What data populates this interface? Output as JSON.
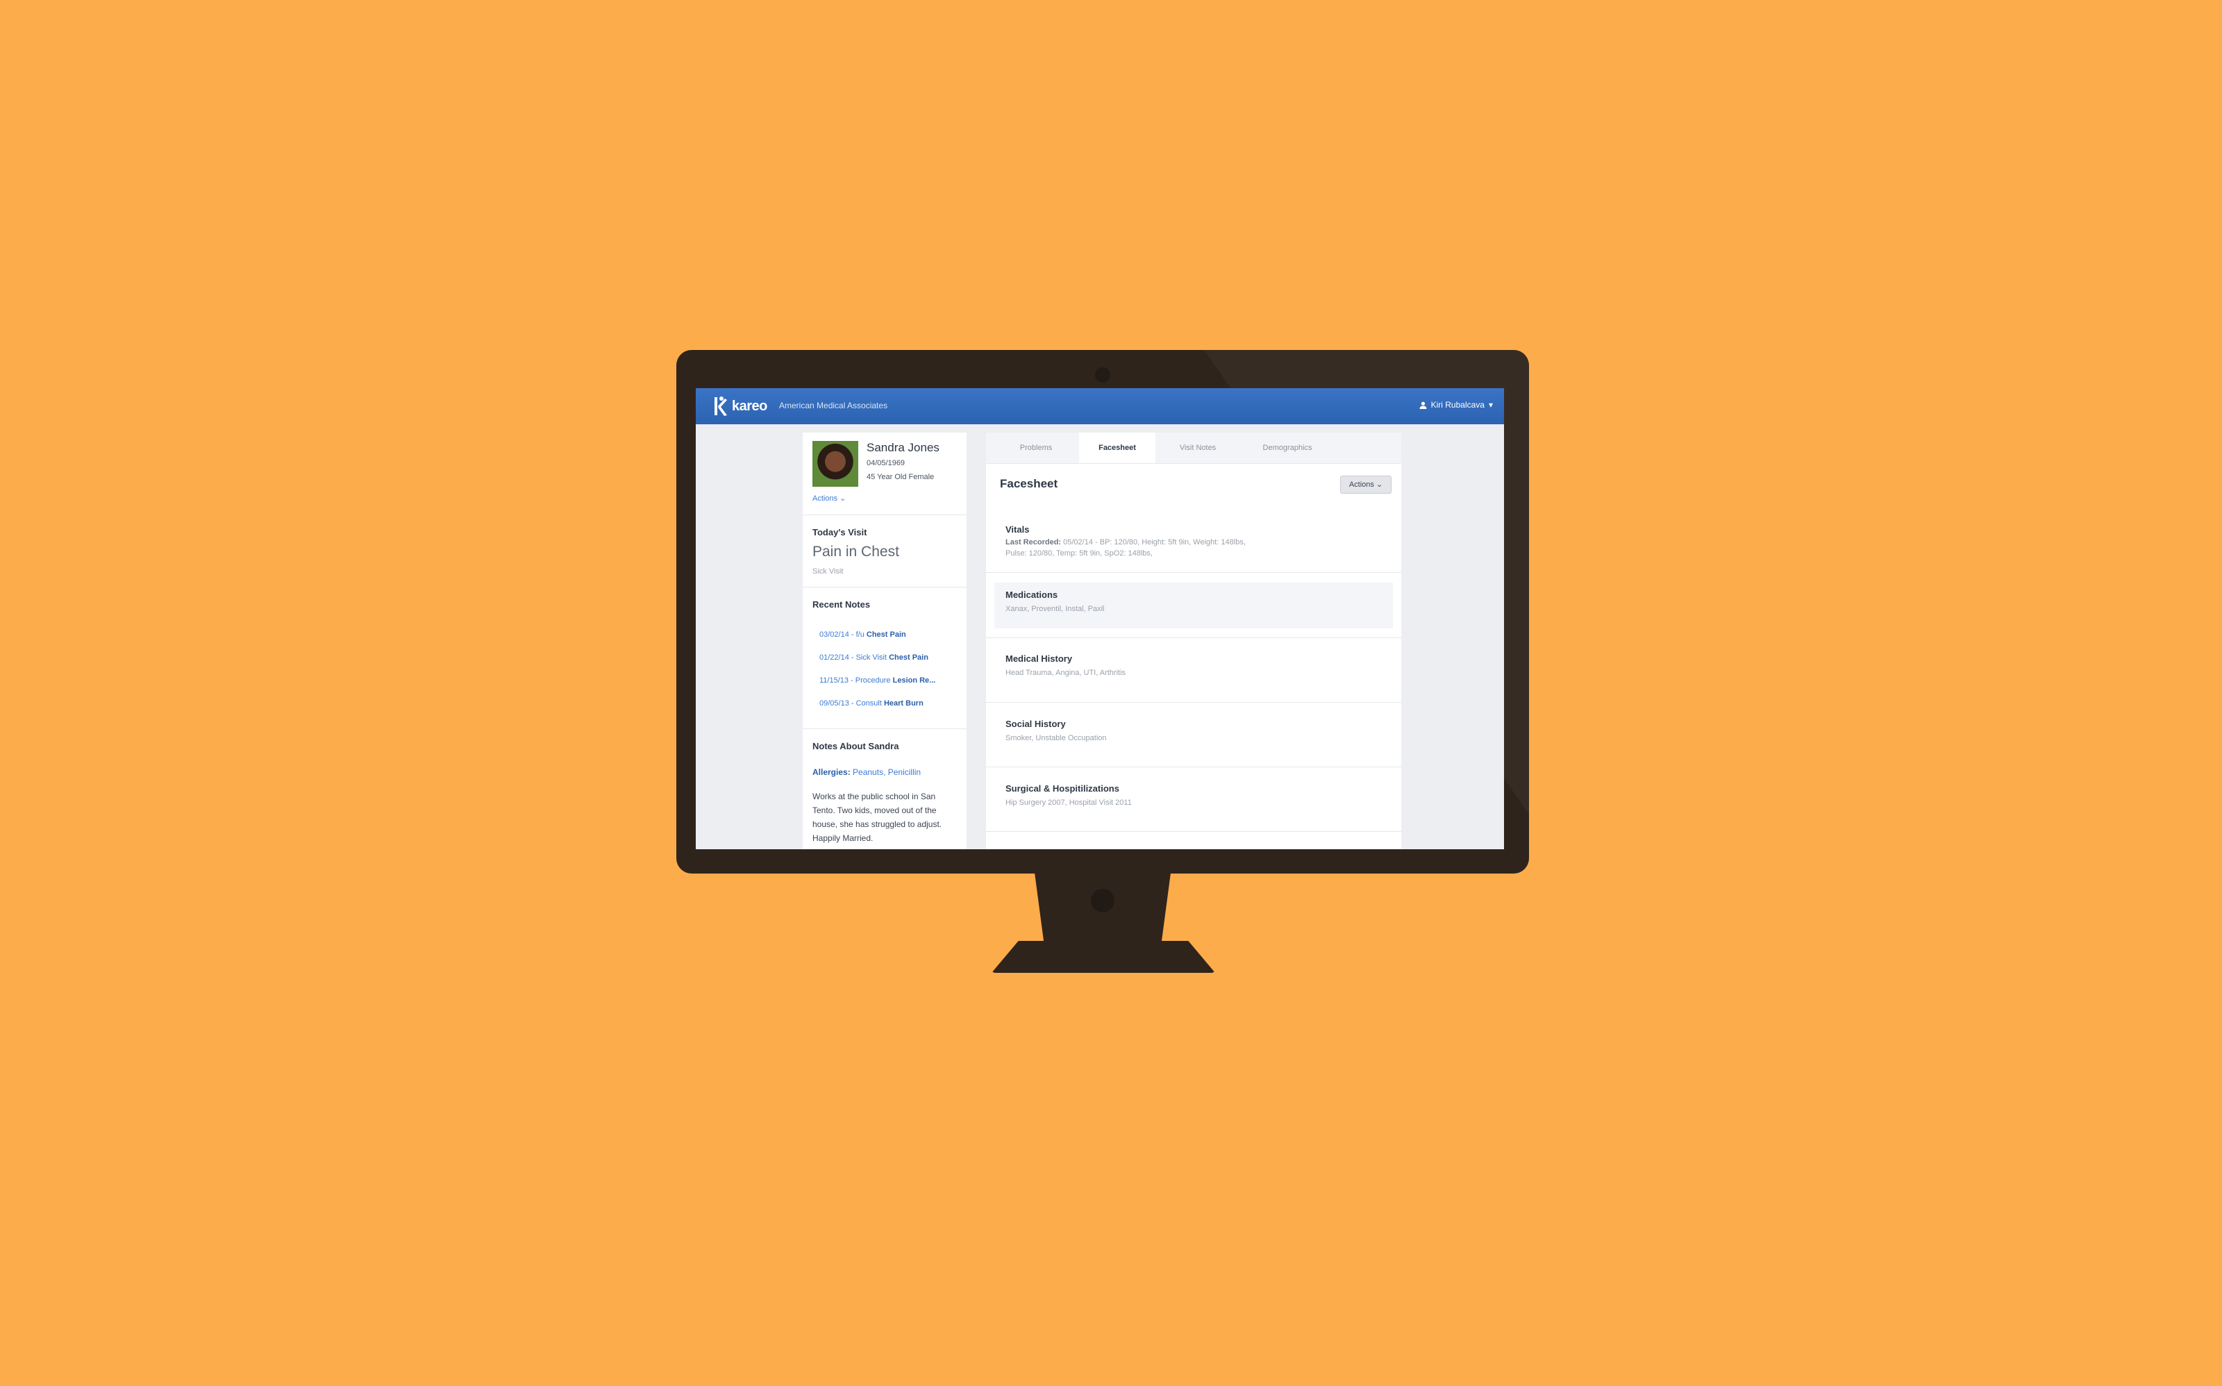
{
  "header": {
    "logo_text": "kareo",
    "practice": "American Medical Associates",
    "user": "Kiri Rubalcava"
  },
  "patient": {
    "name": "Sandra Jones",
    "dob": "04/05/1969",
    "age_sex": "45 Year Old Female",
    "actions_label": "Actions"
  },
  "todays_visit": {
    "title": "Today's Visit",
    "reason": "Pain in Chest",
    "type": "Sick Visit"
  },
  "recent_notes": {
    "title": "Recent Notes",
    "items": [
      {
        "prefix": "03/02/14 - f/u",
        "bold": "Chest Pain"
      },
      {
        "prefix": "01/22/14 - Sick Visit",
        "bold": "Chest Pain"
      },
      {
        "prefix": "11/15/13 - Procedure",
        "bold": "Lesion Re..."
      },
      {
        "prefix": "09/05/13 - Consult",
        "bold": "Heart Burn"
      }
    ]
  },
  "notes_about": {
    "title": "Notes About Sandra",
    "allergies_label": "Allergies:",
    "allergies": "Peanuts, Penicillin",
    "text": "Works at the public school in San Tento. Two kids, moved out of the house, she has struggled to adjust. Happily Married."
  },
  "tabs": [
    "Problems",
    "Facesheet",
    "Visit Notes",
    "Demographics"
  ],
  "active_tab": "Facesheet",
  "facesheet": {
    "title": "Facesheet",
    "actions_label": "Actions",
    "vitals": {
      "title": "Vitals",
      "last_label": "Last Recorded:",
      "line1": "05/02/14 - BP: 120/80, Height: 5ft 9in, Weight: 148lbs,",
      "line2": "Pulse: 120/80, Temp: 5ft 9in, SpO2: 148lbs,"
    },
    "medications": {
      "title": "Medications",
      "text": "Xanax, Proventil, Instal, Paxil"
    },
    "medical_history": {
      "title": "Medical History",
      "text": "Head Trauma, Angina, UTI, Arthritis"
    },
    "social_history": {
      "title": "Social History",
      "text": "Smoker, Unstable Occupation"
    },
    "surgical": {
      "title": "Surgical & Hospitilizations",
      "text": "Hip Surgery 2007, Hospital Visit 2011"
    }
  },
  "colors": {
    "background": "#fdac4b",
    "monitor": "#2f241c",
    "header_blue": "#3b74c5",
    "link_blue": "#3a7bd5"
  }
}
